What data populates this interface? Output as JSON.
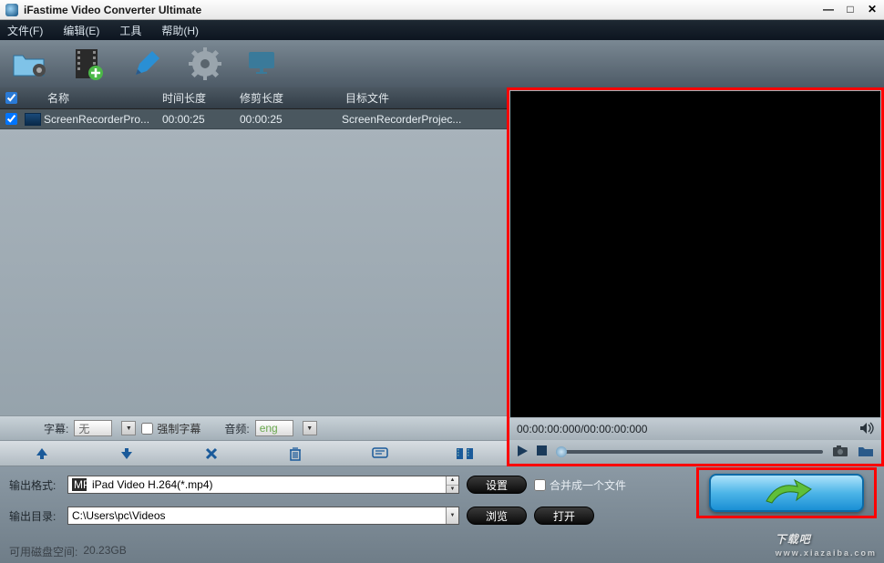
{
  "title": "iFastime Video Converter Ultimate",
  "menu": {
    "file": "文件(F)",
    "edit": "编辑(E)",
    "tool": "工具",
    "help": "帮助(H)"
  },
  "columns": {
    "name": "名称",
    "time": "时间长度",
    "trim": "修剪长度",
    "target": "目标文件"
  },
  "rows": [
    {
      "name": "ScreenRecorderPro...",
      "time": "00:00:25",
      "trim": "00:00:25",
      "target": "ScreenRecorderProjec..."
    }
  ],
  "subtitle": {
    "label": "字幕:",
    "value": "无",
    "force": "强制字幕"
  },
  "audio": {
    "label": "音频:",
    "value": "eng"
  },
  "preview": {
    "time": "00:00:00:000/00:00:00:000"
  },
  "output": {
    "format_label": "输出格式:",
    "format_value": "iPad Video H.264(*.mp4)",
    "dir_label": "输出目录:",
    "dir_value": "C:\\Users\\pc\\Videos",
    "settings": "设置",
    "browse": "浏览",
    "open": "打开",
    "merge": "合并成一个文件"
  },
  "disk": {
    "label": "可用磁盘空间:",
    "value": "20.23GB"
  },
  "watermark": {
    "text": "下载吧",
    "sub": "www.xiazaiba.com"
  }
}
